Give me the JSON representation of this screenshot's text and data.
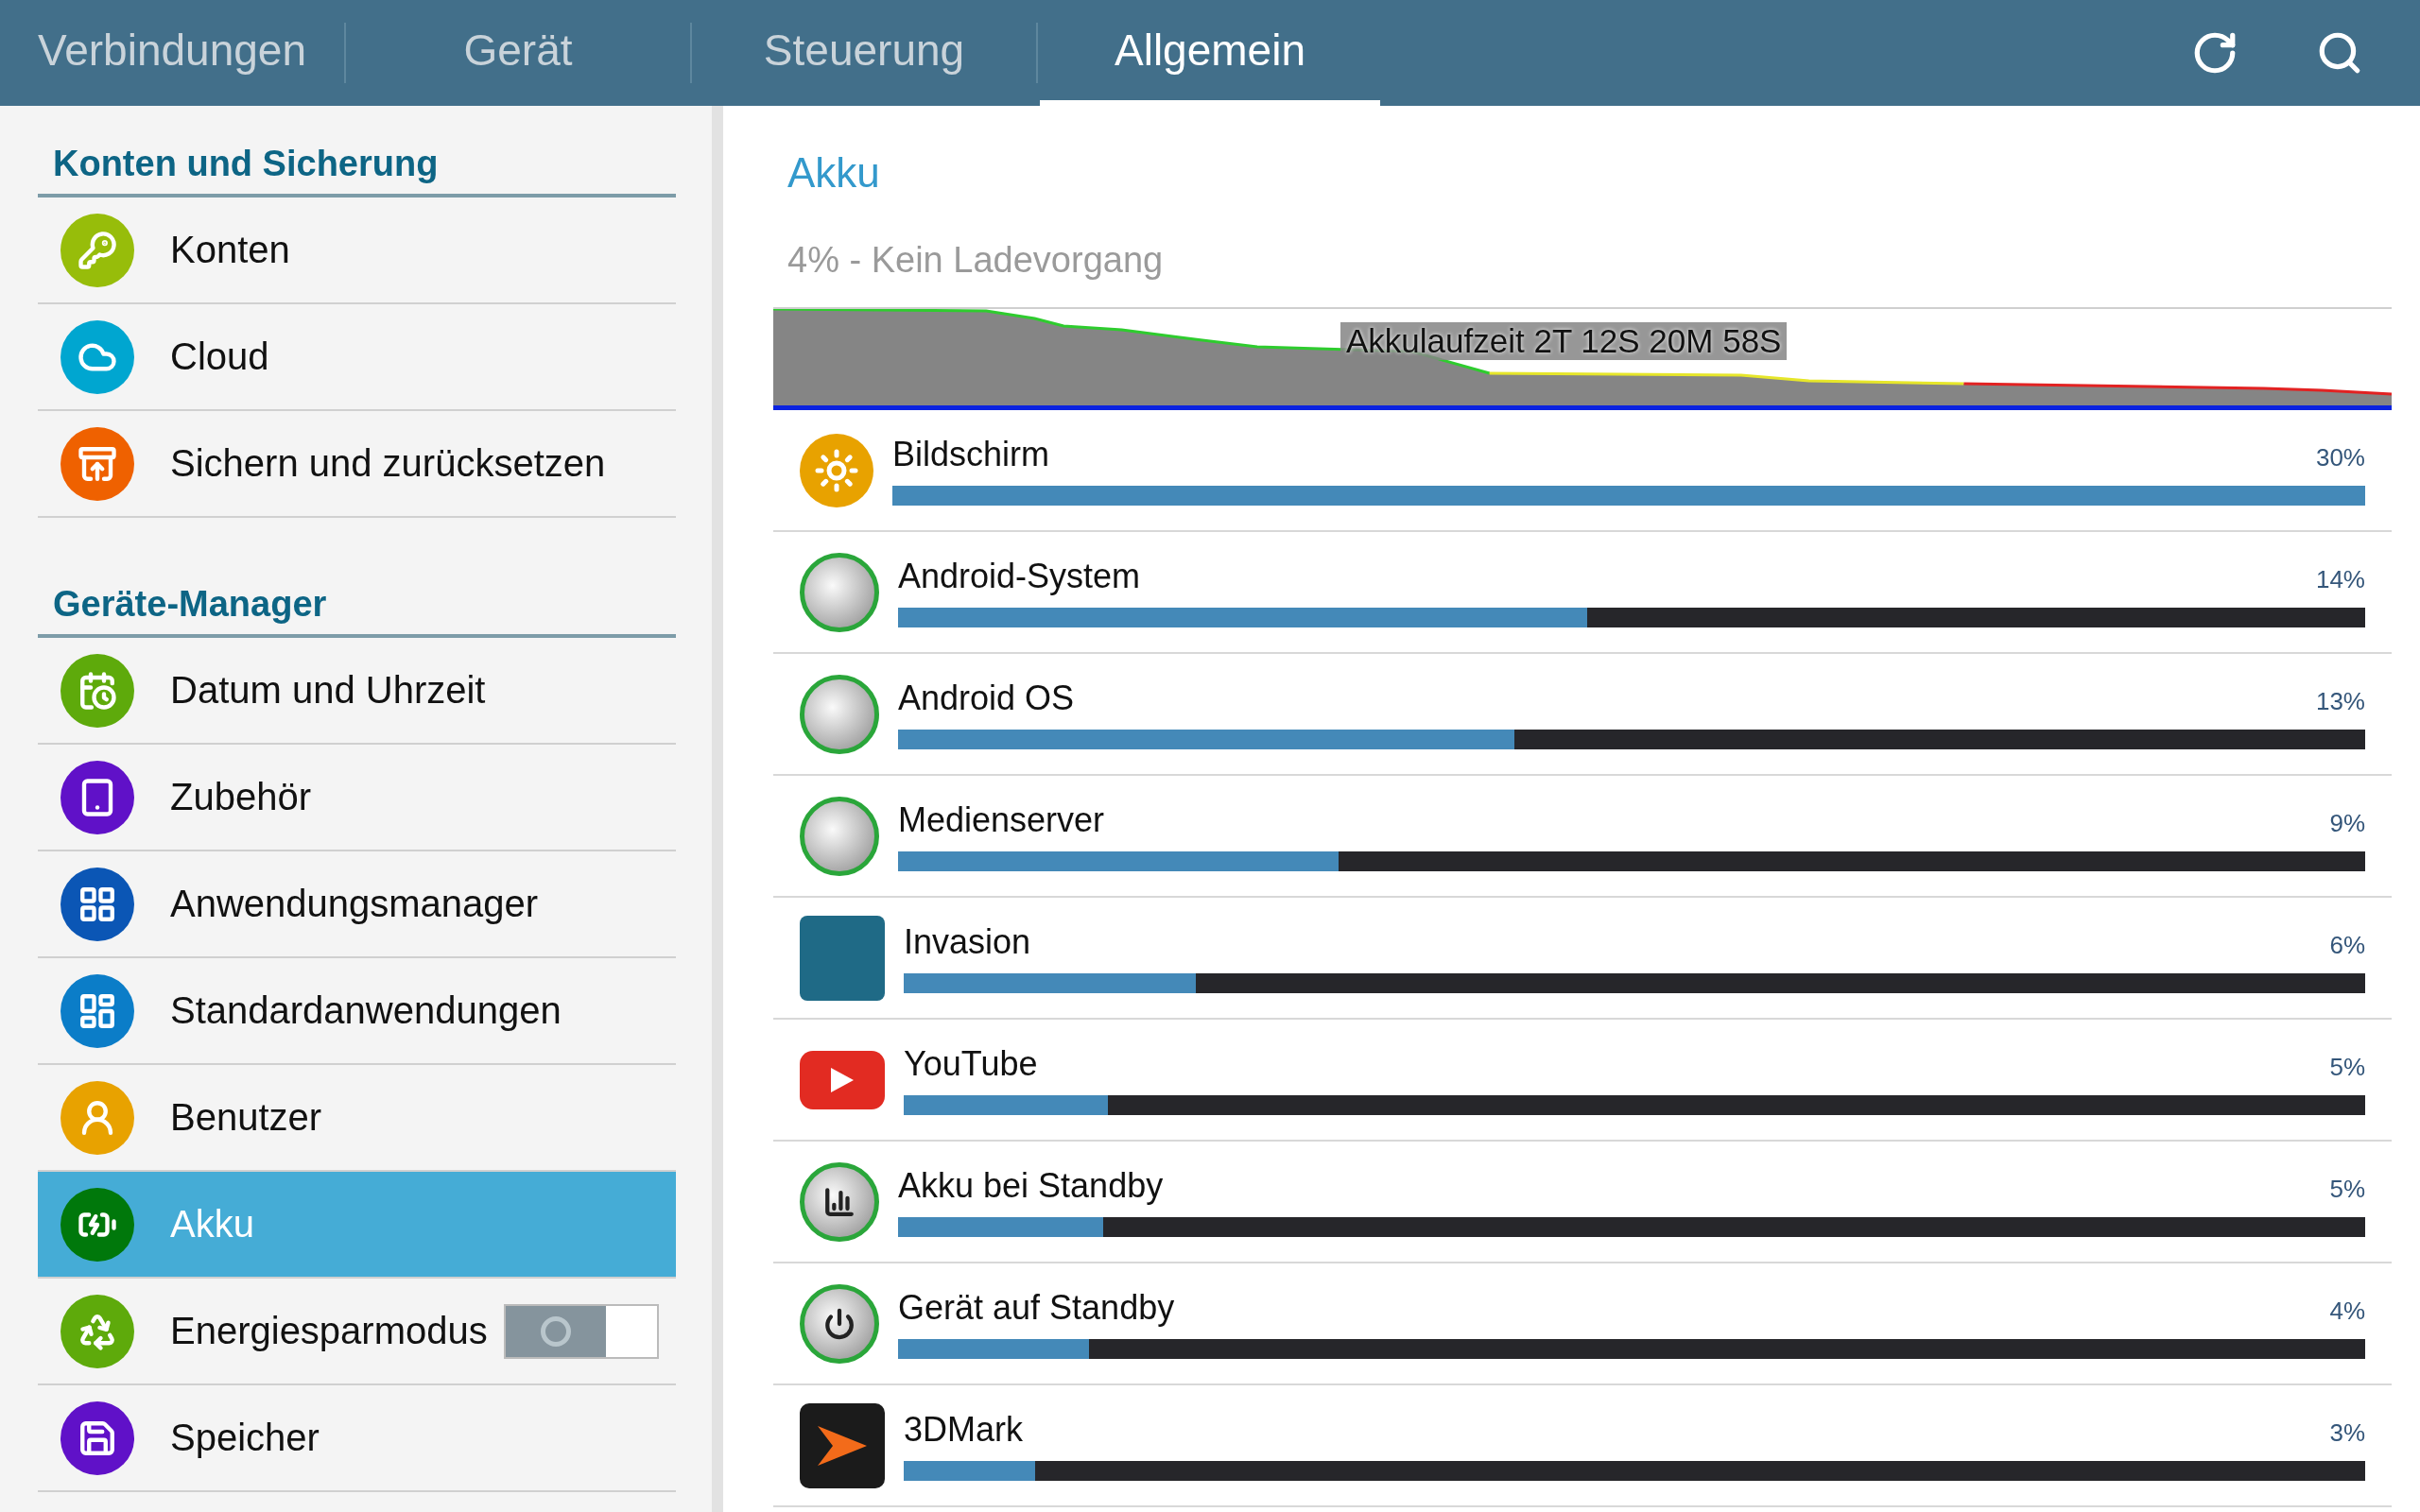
{
  "tabs": [
    {
      "label": "Verbindungen",
      "selected": false
    },
    {
      "label": "Gerät",
      "selected": false
    },
    {
      "label": "Steuerung",
      "selected": false
    },
    {
      "label": "Allgemein",
      "selected": true
    }
  ],
  "sidebar": {
    "sections": [
      {
        "title": "Konten und Sicherung",
        "items": [
          {
            "label": "Konten",
            "kind": "link",
            "selected": false
          },
          {
            "label": "Cloud",
            "kind": "link",
            "selected": false
          },
          {
            "label": "Sichern und zurücksetzen",
            "kind": "link",
            "selected": false
          }
        ]
      },
      {
        "title": "Geräte-Manager",
        "items": [
          {
            "label": "Datum und Uhrzeit",
            "kind": "link",
            "selected": false
          },
          {
            "label": "Zubehör",
            "kind": "link",
            "selected": false
          },
          {
            "label": "Anwendungsmanager",
            "kind": "link",
            "selected": false
          },
          {
            "label": "Standardanwendungen",
            "kind": "link",
            "selected": false
          },
          {
            "label": "Benutzer",
            "kind": "link",
            "selected": false
          },
          {
            "label": "Akku",
            "kind": "link",
            "selected": true
          },
          {
            "label": "Energiesparmodus",
            "kind": "toggle",
            "selected": false,
            "on": false
          },
          {
            "label": "Speicher",
            "kind": "link",
            "selected": false
          }
        ]
      }
    ]
  },
  "battery": {
    "title": "Akku",
    "status": "4% - Kein Ladevorgang",
    "graph_label": "Akkulaufzeit 2T 12S 20M 58S",
    "apps": [
      {
        "name": "Bildschirm",
        "percent": "30%",
        "level": 1
      },
      {
        "name": "Android-System",
        "percent": "14%",
        "level": 0.47
      },
      {
        "name": "Android OS",
        "percent": "13%",
        "level": 0.42
      },
      {
        "name": "Medienserver",
        "percent": "9%",
        "level": 0.3
      },
      {
        "name": "Invasion",
        "percent": "6%",
        "level": 0.2
      },
      {
        "name": "YouTube",
        "percent": "5%",
        "level": 0.14
      },
      {
        "name": "Akku bei Standby",
        "percent": "5%",
        "level": 0.14
      },
      {
        "name": "Gerät auf Standby",
        "percent": "4%",
        "level": 0.13
      },
      {
        "name": "3DMark",
        "percent": "3%",
        "level": 0.09
      }
    ]
  }
}
